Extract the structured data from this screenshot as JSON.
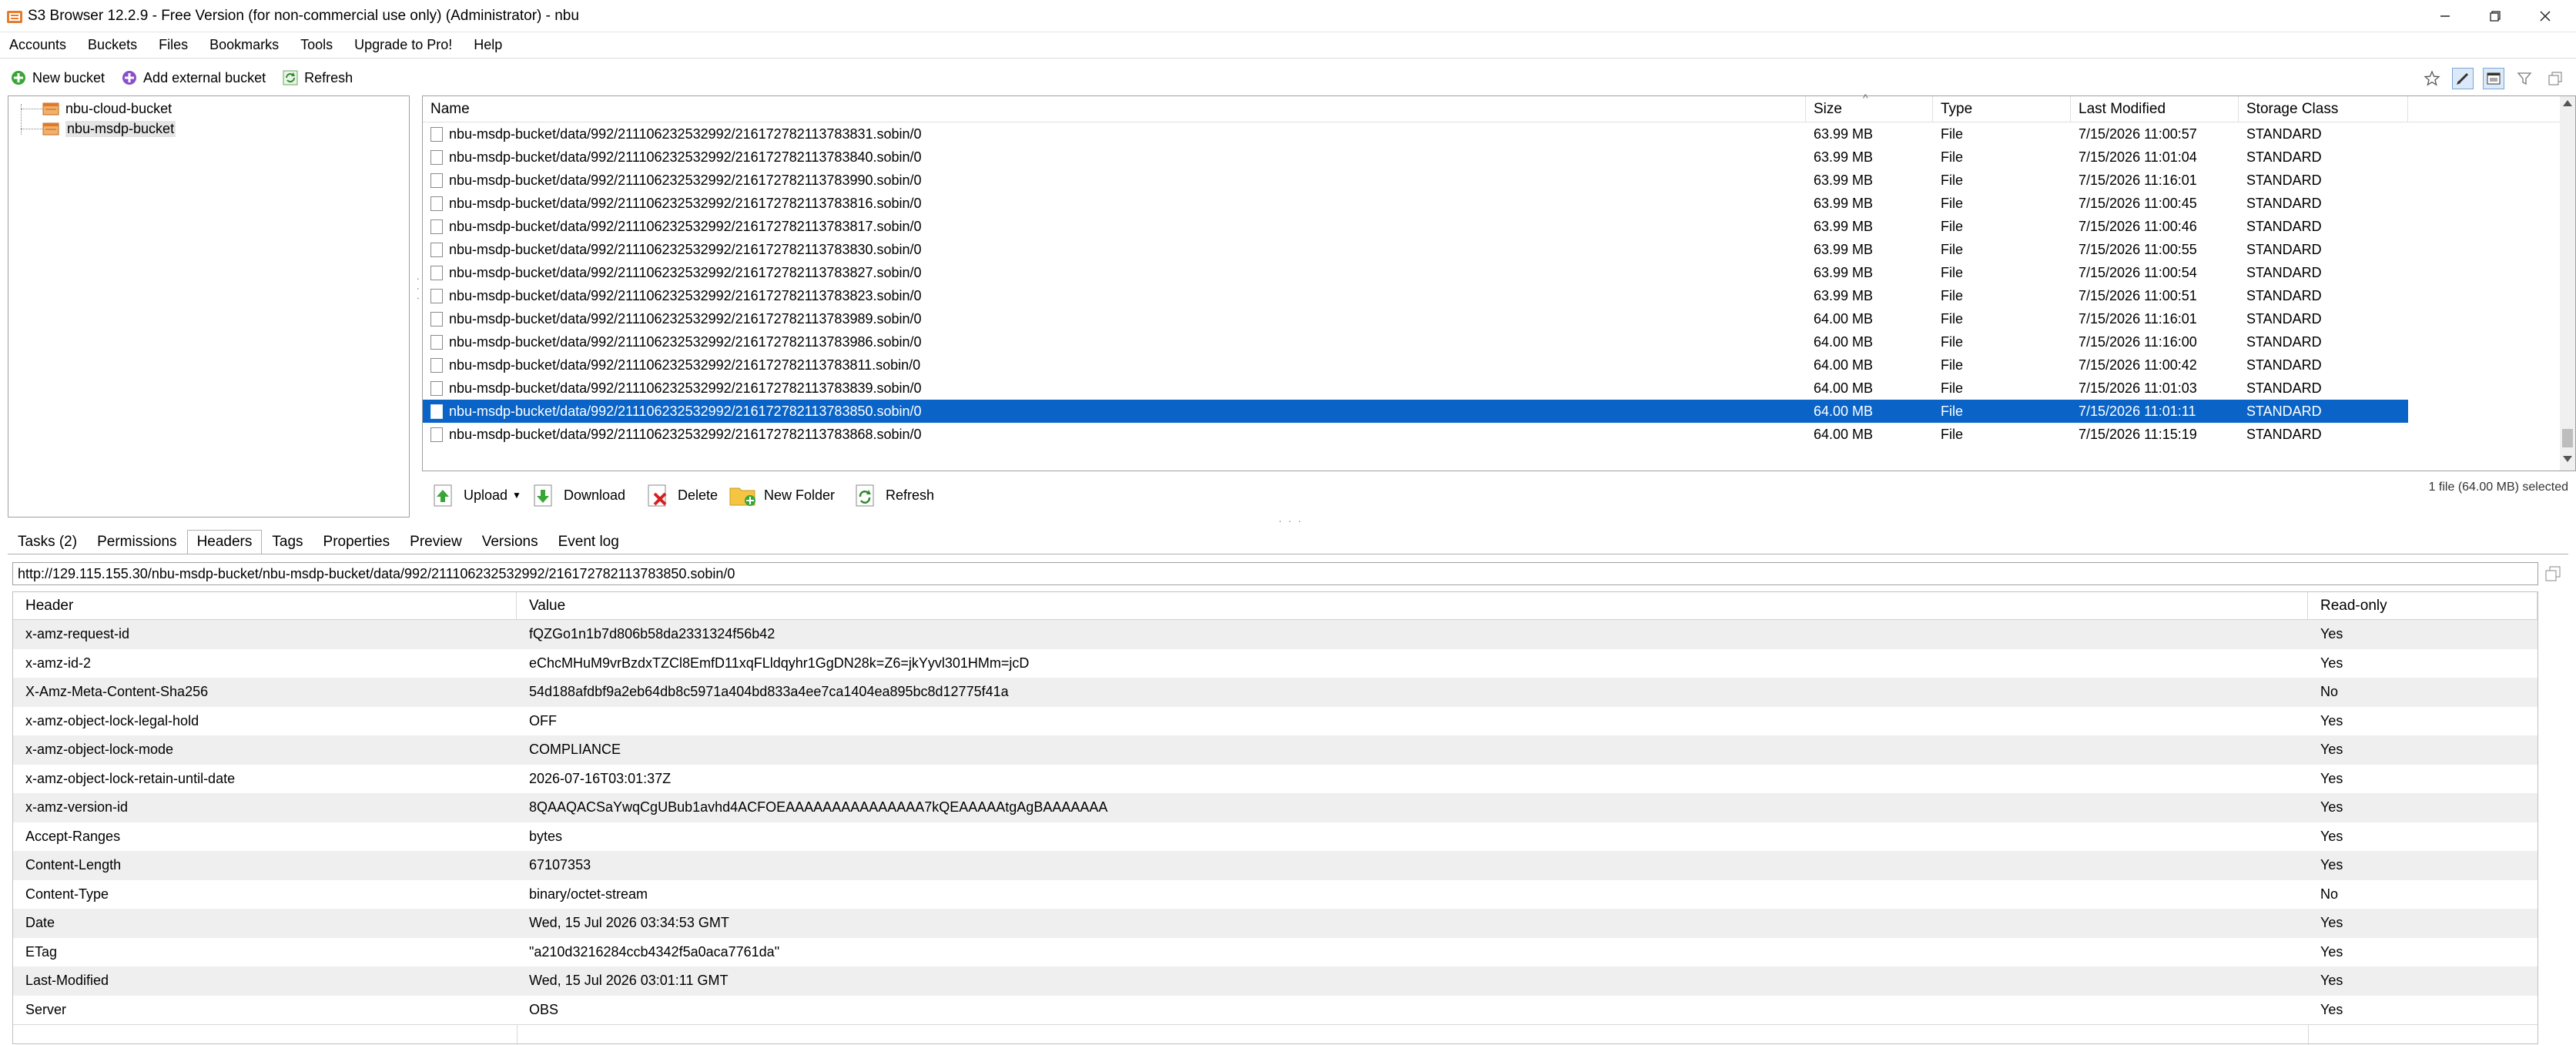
{
  "window": {
    "title": "S3 Browser 12.2.9 - Free Version (for non-commercial use only) (Administrator) - nbu",
    "icon": "s3-browser-app-icon",
    "controls": [
      "minimize-icon",
      "maximize-icon",
      "close-icon"
    ]
  },
  "menu": [
    "Accounts",
    "Buckets",
    "Files",
    "Bookmarks",
    "Tools",
    "Upgrade to Pro!",
    "Help"
  ],
  "left_toolbar": {
    "new_bucket": "New bucket",
    "add_external_bucket": "Add external bucket",
    "refresh": "Refresh"
  },
  "buckets": [
    {
      "name": "nbu-cloud-bucket",
      "selected": false
    },
    {
      "name": "nbu-msdp-bucket",
      "selected": true
    }
  ],
  "right_toolbar_icons": [
    "star-icon",
    "pencil-icon",
    "window-icon",
    "filter-icon",
    "copy-icon"
  ],
  "objects": {
    "columns": [
      "Name",
      "Size",
      "Type",
      "Last Modified",
      "Storage Class"
    ],
    "rows": [
      {
        "name": "nbu-msdp-bucket/data/992/211106232532992/216172782113783831.sobin/0",
        "size": "63.99 MB",
        "type": "File",
        "modified": "7/15/2026 11:00:57",
        "class": "STANDARD",
        "selected": false
      },
      {
        "name": "nbu-msdp-bucket/data/992/211106232532992/216172782113783840.sobin/0",
        "size": "63.99 MB",
        "type": "File",
        "modified": "7/15/2026 11:01:04",
        "class": "STANDARD",
        "selected": false
      },
      {
        "name": "nbu-msdp-bucket/data/992/211106232532992/216172782113783990.sobin/0",
        "size": "63.99 MB",
        "type": "File",
        "modified": "7/15/2026 11:16:01",
        "class": "STANDARD",
        "selected": false
      },
      {
        "name": "nbu-msdp-bucket/data/992/211106232532992/216172782113783816.sobin/0",
        "size": "63.99 MB",
        "type": "File",
        "modified": "7/15/2026 11:00:45",
        "class": "STANDARD",
        "selected": false
      },
      {
        "name": "nbu-msdp-bucket/data/992/211106232532992/216172782113783817.sobin/0",
        "size": "63.99 MB",
        "type": "File",
        "modified": "7/15/2026 11:00:46",
        "class": "STANDARD",
        "selected": false
      },
      {
        "name": "nbu-msdp-bucket/data/992/211106232532992/216172782113783830.sobin/0",
        "size": "63.99 MB",
        "type": "File",
        "modified": "7/15/2026 11:00:55",
        "class": "STANDARD",
        "selected": false
      },
      {
        "name": "nbu-msdp-bucket/data/992/211106232532992/216172782113783827.sobin/0",
        "size": "63.99 MB",
        "type": "File",
        "modified": "7/15/2026 11:00:54",
        "class": "STANDARD",
        "selected": false
      },
      {
        "name": "nbu-msdp-bucket/data/992/211106232532992/216172782113783823.sobin/0",
        "size": "63.99 MB",
        "type": "File",
        "modified": "7/15/2026 11:00:51",
        "class": "STANDARD",
        "selected": false
      },
      {
        "name": "nbu-msdp-bucket/data/992/211106232532992/216172782113783989.sobin/0",
        "size": "64.00 MB",
        "type": "File",
        "modified": "7/15/2026 11:16:01",
        "class": "STANDARD",
        "selected": false
      },
      {
        "name": "nbu-msdp-bucket/data/992/211106232532992/216172782113783986.sobin/0",
        "size": "64.00 MB",
        "type": "File",
        "modified": "7/15/2026 11:16:00",
        "class": "STANDARD",
        "selected": false
      },
      {
        "name": "nbu-msdp-bucket/data/992/211106232532992/216172782113783811.sobin/0",
        "size": "64.00 MB",
        "type": "File",
        "modified": "7/15/2026 11:00:42",
        "class": "STANDARD",
        "selected": false
      },
      {
        "name": "nbu-msdp-bucket/data/992/211106232532992/216172782113783839.sobin/0",
        "size": "64.00 MB",
        "type": "File",
        "modified": "7/15/2026 11:01:03",
        "class": "STANDARD",
        "selected": false
      },
      {
        "name": "nbu-msdp-bucket/data/992/211106232532992/216172782113783850.sobin/0",
        "size": "64.00 MB",
        "type": "File",
        "modified": "7/15/2026 11:01:11",
        "class": "STANDARD",
        "selected": true
      },
      {
        "name": "nbu-msdp-bucket/data/992/211106232532992/216172782113783868.sobin/0",
        "size": "64.00 MB",
        "type": "File",
        "modified": "7/15/2026 11:15:19",
        "class": "STANDARD",
        "selected": false
      }
    ]
  },
  "object_toolbar": {
    "upload": "Upload",
    "download": "Download",
    "delete": "Delete",
    "new_folder": "New Folder",
    "refresh": "Refresh",
    "selection_status": "1 file (64.00 MB) selected"
  },
  "tabs": [
    {
      "label": "Tasks (2)",
      "active": false
    },
    {
      "label": "Permissions",
      "active": false
    },
    {
      "label": "Headers",
      "active": true
    },
    {
      "label": "Tags",
      "active": false
    },
    {
      "label": "Properties",
      "active": false
    },
    {
      "label": "Preview",
      "active": false
    },
    {
      "label": "Versions",
      "active": false
    },
    {
      "label": "Event log",
      "active": false
    }
  ],
  "url": "http://129.115.155.30/nbu-msdp-bucket/nbu-msdp-bucket/data/992/211106232532992/216172782113783850.sobin/0",
  "headers": {
    "columns": [
      "Header",
      "Value",
      "Read-only"
    ],
    "rows": [
      {
        "header": "x-amz-request-id",
        "value": "fQZGo1n1b7d806b58da2331324f56b42",
        "readonly": "Yes"
      },
      {
        "header": "x-amz-id-2",
        "value": "eChcMHuM9vrBzdxTZCl8EmfD11xqFLldqyhr1GgDN28k=Z6=jkYyvl301HMm=jcD",
        "readonly": "Yes"
      },
      {
        "header": "X-Amz-Meta-Content-Sha256",
        "value": "54d188afdbf9a2eb64db8c5971a404bd833a4ee7ca1404ea895bc8d12775f41a",
        "readonly": "No"
      },
      {
        "header": "x-amz-object-lock-legal-hold",
        "value": "OFF",
        "readonly": "Yes"
      },
      {
        "header": "x-amz-object-lock-mode",
        "value": "COMPLIANCE",
        "readonly": "Yes"
      },
      {
        "header": "x-amz-object-lock-retain-until-date",
        "value": "2026-07-16T03:01:37Z",
        "readonly": "Yes"
      },
      {
        "header": "x-amz-version-id",
        "value": "8QAAQACSaYwqCgUBub1avhd4ACFOEAAAAAAAAAAAAAAA7kQEAAAAAtgAgBAAAAAAA",
        "readonly": "Yes"
      },
      {
        "header": "Accept-Ranges",
        "value": "bytes",
        "readonly": "Yes"
      },
      {
        "header": "Content-Length",
        "value": "67107353",
        "readonly": "Yes"
      },
      {
        "header": "Content-Type",
        "value": "binary/octet-stream",
        "readonly": "No"
      },
      {
        "header": "Date",
        "value": "Wed, 15 Jul 2026 03:34:53 GMT",
        "readonly": "Yes"
      },
      {
        "header": "ETag",
        "value": "\"a210d3216284ccb4342f5a0aca7761da\"",
        "readonly": "Yes"
      },
      {
        "header": "Last-Modified",
        "value": "Wed, 15 Jul 2026 03:01:11 GMT",
        "readonly": "Yes"
      },
      {
        "header": "Server",
        "value": "OBS",
        "readonly": "Yes"
      }
    ]
  },
  "colors": {
    "selection": "#0a64c8",
    "alt_row": "#efefef",
    "border": "#a0a0a0"
  }
}
